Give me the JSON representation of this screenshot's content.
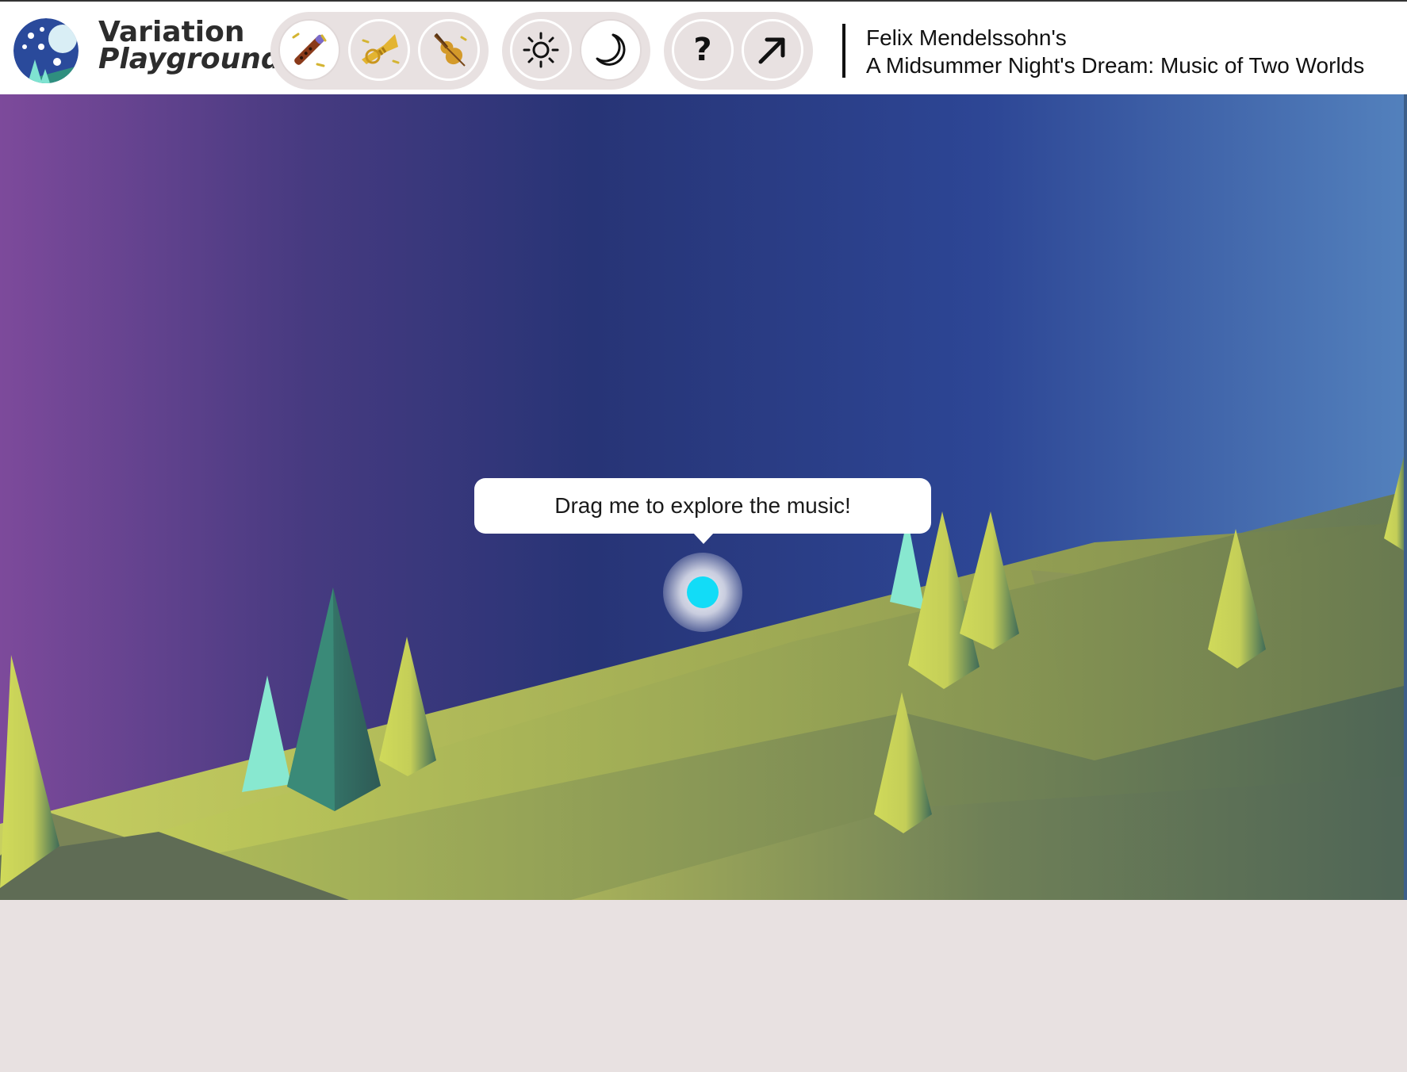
{
  "app": {
    "logo_line1": "Variation",
    "logo_line2": "Playground"
  },
  "toolbar": {
    "instrument_buttons": [
      {
        "icon": "flute-icon"
      },
      {
        "icon": "trumpet-icon"
      },
      {
        "icon": "violin-icon"
      }
    ],
    "mode_buttons": [
      {
        "icon": "sun-icon"
      },
      {
        "icon": "moon-icon"
      }
    ],
    "help_label": "?",
    "share_icon": "arrow-up-right-icon"
  },
  "piece": {
    "composer": "Felix Mendelssohn's",
    "title": "A Midsummer Night's Dream: Music of Two Worlds"
  },
  "scene": {
    "tooltip": "Drag me to explore the music!",
    "dot_color": "#12dcf7"
  },
  "colors": {
    "sky_left": "#7d4a9b",
    "sky_mid": "#273476",
    "sky_right": "#5381bd",
    "ground": "#b7c05a",
    "panel": "#e8e1e1"
  }
}
